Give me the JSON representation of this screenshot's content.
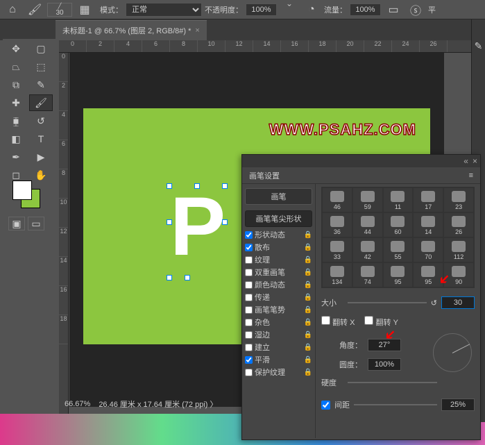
{
  "toolbar": {
    "brush_size": "30",
    "mode_label": "模式：",
    "mode_value": "正常",
    "opacity_label": "不透明度：",
    "opacity_value": "100%",
    "flow_label": "流量：",
    "flow_value": "100%",
    "smooth_label": "平"
  },
  "document": {
    "tab_title": "未标题-1 @ 66.7% (图层 2, RGB/8#) *"
  },
  "ruler_h": [
    "0",
    "2",
    "4",
    "6",
    "8",
    "10",
    "12",
    "14",
    "16",
    "18",
    "20",
    "22",
    "24",
    "26"
  ],
  "ruler_v": [
    "0",
    "2",
    "4",
    "6",
    "8",
    "10",
    "12",
    "14",
    "16",
    "18"
  ],
  "canvas": {
    "watermark": "WWW.PSAHZ.COM",
    "letter": "P"
  },
  "status": {
    "zoom": "66.67%",
    "dims": "26.46 厘米 x 17.64 厘米 (72 ppi)  〉"
  },
  "panel": {
    "title": "画笔设置",
    "brush_btn": "画笔",
    "tip_shape": "画笔笔尖形状",
    "left_items": [
      {
        "label": "形状动态",
        "checked": true
      },
      {
        "label": "散布",
        "checked": true
      },
      {
        "label": "纹理",
        "checked": false
      },
      {
        "label": "双重画笔",
        "checked": false
      },
      {
        "label": "颜色动态",
        "checked": false
      },
      {
        "label": "传递",
        "checked": false
      },
      {
        "label": "画笔笔势",
        "checked": false
      },
      {
        "label": "杂色",
        "checked": false
      },
      {
        "label": "湿边",
        "checked": false
      },
      {
        "label": "建立",
        "checked": false
      },
      {
        "label": "平滑",
        "checked": true
      },
      {
        "label": "保护纹理",
        "checked": false
      }
    ],
    "tips": [
      "46",
      "59",
      "11",
      "17",
      "23",
      "36",
      "44",
      "60",
      "14",
      "26",
      "33",
      "42",
      "55",
      "70",
      "112",
      "134",
      "74",
      "95",
      "95",
      "90"
    ],
    "size_label": "大小",
    "size_value": "30",
    "flip_x": "翻转 X",
    "flip_y": "翻转 Y",
    "angle_label": "角度：",
    "angle_value": "27°",
    "round_label": "圆度：",
    "round_value": "100%",
    "hardness_label": "硬度",
    "spacing_label": "间距",
    "spacing_checked": true,
    "spacing_value": "25%"
  }
}
